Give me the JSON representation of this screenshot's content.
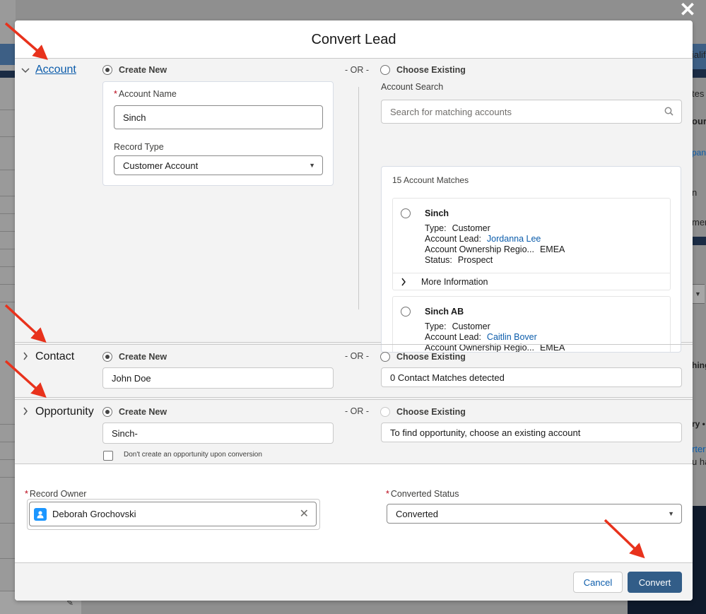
{
  "background": {
    "right_fragments": [
      "ialif",
      "tes",
      "our",
      "pany",
      "n",
      "men",
      "hing",
      "ry •",
      "rter",
      "u ha"
    ]
  },
  "modal": {
    "title": "Convert Lead",
    "close_icon": "close-icon"
  },
  "account": {
    "title": "Account",
    "create_new": "Create New",
    "or": "- OR -",
    "choose_existing": "Choose Existing",
    "account_name_label": "Account Name",
    "account_name_value": "Sinch",
    "record_type_label": "Record Type",
    "record_type_value": "Customer Account",
    "search_label": "Account Search",
    "search_placeholder": "Search for matching accounts",
    "matches_count": "15 Account Matches",
    "matches": [
      {
        "name": "Sinch",
        "type_key": "Type:",
        "type_val": "Customer",
        "lead_key": "Account Lead:",
        "lead_val": "Jordanna Lee",
        "region_key": "Account Ownership Regio...",
        "region_val": "EMEA",
        "status_key": "Status:",
        "status_val": "Prospect",
        "more_info": "More Information"
      },
      {
        "name": "Sinch AB",
        "type_key": "Type:",
        "type_val": "Customer",
        "lead_key": "Account Lead:",
        "lead_val": "Caitlin Bover",
        "region_key": "Account Ownership Regio...",
        "region_val": "EMEA"
      }
    ]
  },
  "contact": {
    "title": "Contact",
    "create_new": "Create New",
    "or": "- OR -",
    "choose_existing": "Choose Existing",
    "name_value": "John Doe",
    "matches_text": "0 Contact Matches detected"
  },
  "opportunity": {
    "title": "Opportunity",
    "create_new": "Create New",
    "or": "- OR -",
    "choose_existing": "Choose Existing",
    "name_value": "Sinch-",
    "existing_text": "To find opportunity, choose an existing account",
    "no_opp_label": "Don't create an opportunity upon conversion"
  },
  "owner": {
    "record_owner_label": "Record Owner",
    "record_owner_value": "Deborah Grochovski",
    "converted_status_label": "Converted Status",
    "converted_status_value": "Converted"
  },
  "footer": {
    "cancel": "Cancel",
    "convert": "Convert"
  },
  "colors": {
    "brand": "#325d88",
    "link": "#0b5cab",
    "required": "#ba0517",
    "annotation_arrow": "#e8321c"
  }
}
